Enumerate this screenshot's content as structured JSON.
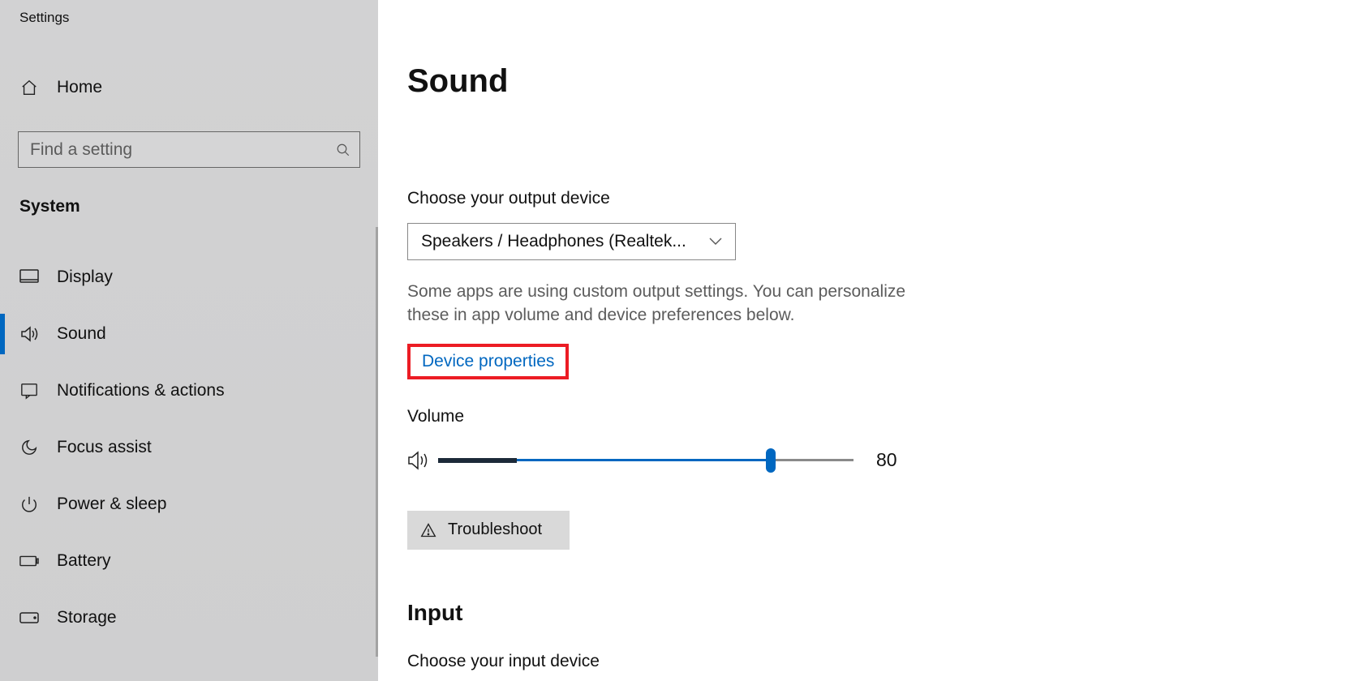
{
  "app_title": "Settings",
  "sidebar": {
    "home_label": "Home",
    "search_placeholder": "Find a setting",
    "category": "System",
    "items": [
      {
        "label": "Display"
      },
      {
        "label": "Sound"
      },
      {
        "label": "Notifications & actions"
      },
      {
        "label": "Focus assist"
      },
      {
        "label": "Power & sleep"
      },
      {
        "label": "Battery"
      },
      {
        "label": "Storage"
      }
    ]
  },
  "main": {
    "title": "Sound",
    "output_label": "Choose your output device",
    "output_selected": "Speakers / Headphones (Realtek...",
    "output_helper": "Some apps are using custom output settings. You can personalize these in app volume and device preferences below.",
    "device_properties_link": "Device properties",
    "volume_label": "Volume",
    "volume_value": "80",
    "troubleshoot_label": "Troubleshoot",
    "input_heading": "Input",
    "input_label": "Choose your input device"
  },
  "colors": {
    "accent": "#0067c0",
    "highlight_box": "#ec1c24"
  }
}
